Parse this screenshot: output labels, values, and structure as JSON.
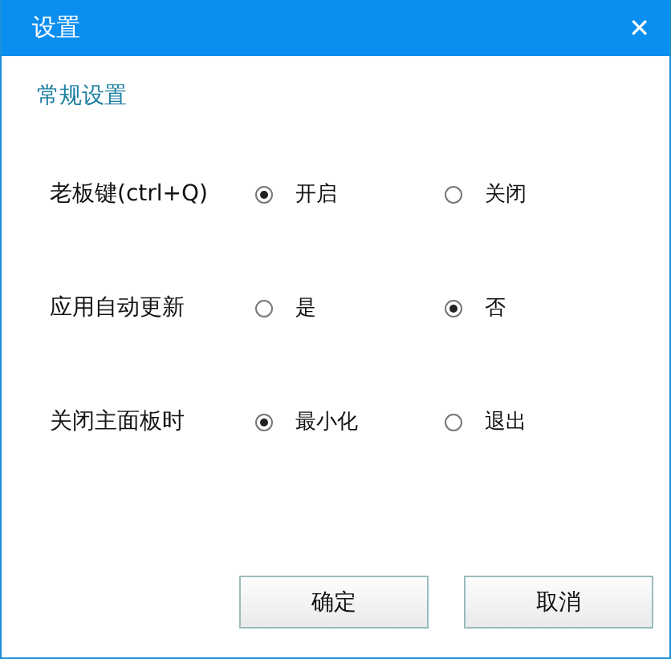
{
  "window": {
    "title": "设置",
    "close": "✕"
  },
  "section": {
    "title": "常规设置"
  },
  "settings": [
    {
      "label": "老板键(ctrl+Q)",
      "options": [
        {
          "label": "开启",
          "selected": true
        },
        {
          "label": "关闭",
          "selected": false
        }
      ]
    },
    {
      "label": "应用自动更新",
      "options": [
        {
          "label": "是",
          "selected": false
        },
        {
          "label": "否",
          "selected": true
        }
      ]
    },
    {
      "label": "关闭主面板时",
      "options": [
        {
          "label": "最小化",
          "selected": true
        },
        {
          "label": "退出",
          "selected": false
        }
      ]
    }
  ],
  "buttons": [
    "确定",
    "取消"
  ]
}
